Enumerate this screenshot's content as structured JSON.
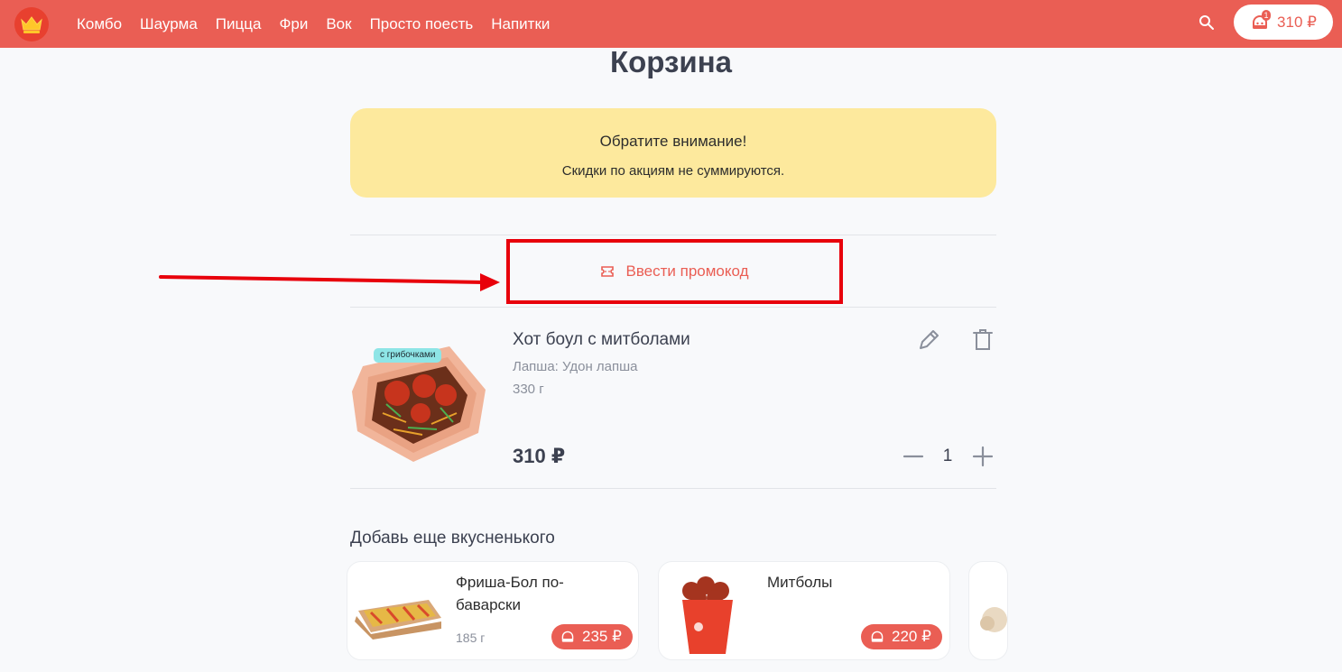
{
  "header": {
    "nav": [
      "Комбо",
      "Шаурма",
      "Пицца",
      "Фри",
      "Вок",
      "Просто поесть",
      "Напитки"
    ],
    "cart_total": "310 ₽",
    "cart_count": "1",
    "icons": {
      "logo": "crown-logo",
      "search": "search-icon",
      "cart": "chef-cart-icon"
    }
  },
  "page": {
    "title": "Корзина"
  },
  "notice": {
    "title": "Обратите внимание!",
    "text": "Скидки по акциям не суммируются."
  },
  "promo": {
    "label": "Ввести промокод",
    "icon": "ticket-icon",
    "highlight_color": "#e8000b"
  },
  "cart_item": {
    "tag": "с грибочками",
    "name": "Хот боул с митболами",
    "option": "Лапша: Удон лапша",
    "weight": "330 г",
    "price": "310 ₽",
    "quantity": "1"
  },
  "recommendations": {
    "title": "Добавь еще вкусненького",
    "items": [
      {
        "name": "Фриша-Бол по-баварски",
        "weight": "185 г",
        "price": "235 ₽"
      },
      {
        "name": "Митболы",
        "weight": "",
        "price": "220 ₽"
      }
    ]
  },
  "colors": {
    "brand": "#ea5e54",
    "notice_bg": "#fde99d",
    "text": "#3c4150",
    "muted": "#8a8f9b"
  }
}
